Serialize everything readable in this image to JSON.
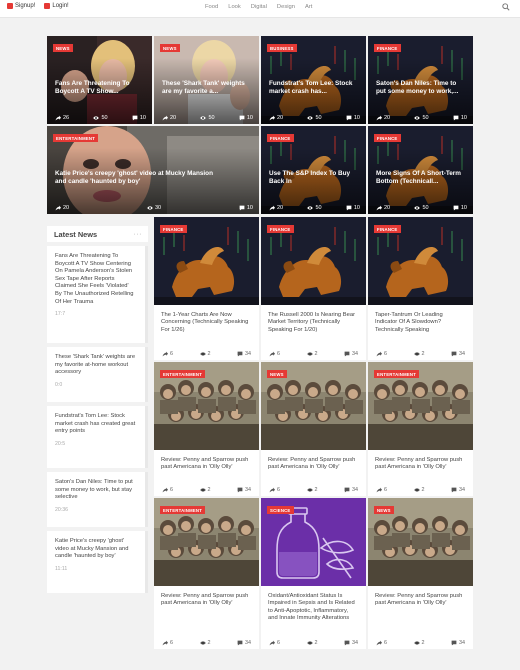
{
  "topbar": {
    "auth": [
      {
        "label": "Signup!",
        "icon": "signup-icon"
      },
      {
        "label": "Login!",
        "icon": "login-icon"
      }
    ],
    "nav": [
      "Food",
      "Look",
      "Digital",
      "Design",
      "Art"
    ],
    "search_icon": "search-icon"
  },
  "hero": [
    {
      "badge": "News",
      "title": "Fans Are Threatening To Boycott A TV Show...",
      "shares": "26",
      "views": "50",
      "comments": "10",
      "image": "portrait-woman-dark"
    },
    {
      "badge": "News",
      "title": "These 'Shark Tank' weights are my favorite a...",
      "shares": "20",
      "views": "50",
      "comments": "10",
      "image": "portrait-woman-light"
    },
    {
      "badge": "Business",
      "title": "Fundstrat's Tom Lee: Stock market crash has...",
      "shares": "20",
      "views": "50",
      "comments": "10",
      "image": "bull-bear-chart"
    },
    {
      "badge": "Finance",
      "title": "Saton's Dan Niles: Time to put some money to work,...",
      "shares": "20",
      "views": "50",
      "comments": "10",
      "image": "bull-bear-chart"
    },
    {
      "badge": "Entertainment",
      "title": "Katie Price's creepy 'ghost' video at Mucky Mansion and candle 'haunted by boy'",
      "shares": "20",
      "views": "30",
      "comments": "10",
      "image": "face-closeup"
    },
    {
      "badge": "Finance",
      "title": "Use The S&P Index To Buy Back In",
      "shares": "20",
      "views": "50",
      "comments": "10",
      "image": "bull-bear-chart"
    },
    {
      "badge": "Finance",
      "title": "More Signs Of A Short-Term Bottom (Technicall...",
      "shares": "20",
      "views": "50",
      "comments": "10",
      "image": "bull-bear-chart"
    }
  ],
  "latest": {
    "heading": "Latest News",
    "more": "···",
    "items": [
      {
        "title": "Fans Are Threatening To Boycott A TV Show Centering On Pamela Anderson's Stolen Sex Tape After Reports Claimed She Feels 'Violated' By The Unauthorized Retelling Of Her Trauma",
        "time": "17:7"
      },
      {
        "title": "These 'Shark Tank' weights are my favorite at-home workout accessory",
        "time": "0:0"
      },
      {
        "title": "Fundstrat's Tom Lee: Stock market crash has created great entry points",
        "time": "20:5"
      },
      {
        "title": "Saton's Dan Niles: Time to put some money to work, but stay selective",
        "time": "20:36"
      },
      {
        "title": "Katie Price's creepy 'ghost' video at Mucky Mansion and candle 'haunted by boy'",
        "time": "11:11"
      }
    ]
  },
  "cards": [
    {
      "badge": "Finance",
      "title": "The 1-Year Charts Are Now Concerning (Technically Speaking For 1/26)",
      "shares": "6",
      "views": "2",
      "comments": "34",
      "image": "bull-bear-chart"
    },
    {
      "badge": "Finance",
      "title": "The Russell 2000 Is Nearing Bear Market Territory (Technically Speaking For 1/20)",
      "shares": "6",
      "views": "2",
      "comments": "34",
      "image": "bull-bear-chart"
    },
    {
      "badge": "Finance",
      "title": "Taper-Tantrum Or Leading Indicator Of A Slowdown? Technically Speaking",
      "shares": "6",
      "views": "2",
      "comments": "34",
      "image": "bull-bear-chart"
    },
    {
      "badge": "Entertainment",
      "title": "Review: Penny and Sparrow push past Americana in 'Olly Olly'",
      "shares": "6",
      "views": "2",
      "comments": "34",
      "image": "group-photo"
    },
    {
      "badge": "News",
      "title": "Review: Penny and Sparrow push past Americana in 'Olly Olly'",
      "shares": "6",
      "views": "2",
      "comments": "34",
      "image": "group-photo"
    },
    {
      "badge": "Entertainment",
      "title": "Review: Penny and Sparrow push past Americana in 'Olly Olly'",
      "shares": "6",
      "views": "2",
      "comments": "34",
      "image": "group-photo"
    },
    {
      "badge": "Entertainment",
      "title": "Review: Penny and Sparrow push past Americana in 'Olly Olly'",
      "shares": "6",
      "views": "2",
      "comments": "34",
      "image": "group-photo"
    },
    {
      "badge": "Science",
      "title": "Oxidant/Antioxidant Status Is Impaired in Sepsis and Is Related to Anti-Apoptotic, Inflammatory, and Innate Immunity Alterations",
      "shares": "6",
      "views": "2",
      "comments": "34",
      "image": "bottle-illustration"
    },
    {
      "badge": "News",
      "title": "Review: Penny and Sparrow push past Americana in 'Olly Olly'",
      "shares": "6",
      "views": "2",
      "comments": "34",
      "image": "group-photo"
    }
  ],
  "colors": {
    "accent": "#e53935",
    "background": "#f2f2f2",
    "illustration": "#6b2fa8"
  }
}
